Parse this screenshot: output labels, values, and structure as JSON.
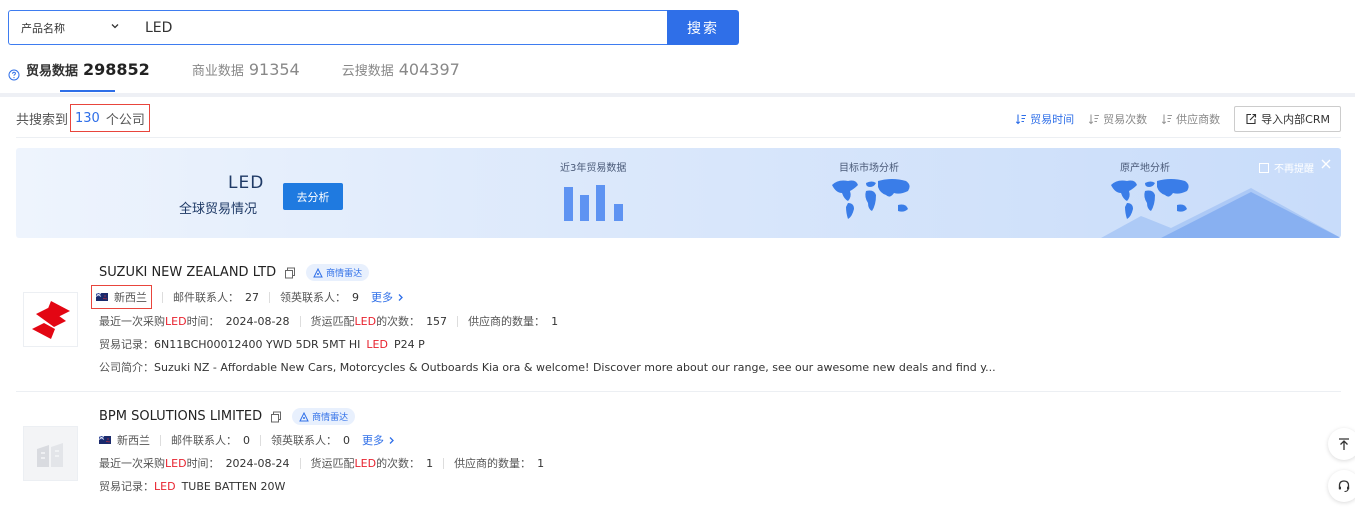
{
  "search": {
    "type_label": "产品名称",
    "query": "LED",
    "button_label": "搜索"
  },
  "tabs": [
    {
      "label": "贸易数据",
      "count": "298852",
      "active": true
    },
    {
      "label": "商业数据",
      "count": "91354",
      "active": false
    },
    {
      "label": "云搜数据",
      "count": "404397",
      "active": false
    }
  ],
  "results": {
    "prefix": "共搜索到",
    "count": "130",
    "unit": "个公司"
  },
  "sort": {
    "items": [
      "贸易时间",
      "贸易次数",
      "供应商数"
    ],
    "crm_button": "导入内部CRM"
  },
  "banner": {
    "keyword": "LED",
    "subtitle": "全球贸易情况",
    "analyze_button": "去分析",
    "sections": [
      "近3年贸易数据",
      "目标市场分析",
      "原产地分析"
    ],
    "no_remind": "不再提醒"
  },
  "companies": [
    {
      "name": "SUZUKI NEW ZEALAND LTD",
      "badge": "商情雷达",
      "country": "新西兰",
      "email_contacts_label": "邮件联系人：",
      "email_contacts": "27",
      "linkedin_contacts_label": "领英联系人：",
      "linkedin_contacts": "9",
      "more_label": "更多",
      "last_purchase_pre": "最近一次采购",
      "last_purchase_kw": "LED",
      "last_purchase_post": "时间：",
      "last_purchase_date": "2024-08-28",
      "match_pre": "货运匹配",
      "match_kw": "LED",
      "match_post": "的次数：",
      "match_count": "157",
      "supplier_label": "供应商的数量：",
      "supplier_count": "1",
      "trade_record_label": "贸易记录：",
      "trade_record_pre": "6N11BCH00012400 YWD 5DR 5MT HI",
      "trade_record_kw": "LED",
      "trade_record_post": "P24 P",
      "intro_label": "公司简介：",
      "intro": "Suzuki NZ - Affordable New Cars, Motorcycles & Outboards Kia ora & welcome! Discover more about our range, see our awesome new deals and find y..."
    },
    {
      "name": "BPM SOLUTIONS LIMITED",
      "badge": "商情雷达",
      "country": "新西兰",
      "email_contacts_label": "邮件联系人：",
      "email_contacts": "0",
      "linkedin_contacts_label": "领英联系人：",
      "linkedin_contacts": "0",
      "more_label": "更多",
      "last_purchase_pre": "最近一次采购",
      "last_purchase_kw": "LED",
      "last_purchase_post": "时间：",
      "last_purchase_date": "2024-08-24",
      "match_pre": "货运匹配",
      "match_kw": "LED",
      "match_post": "的次数：",
      "match_count": "1",
      "supplier_label": "供应商的数量：",
      "supplier_count": "1",
      "trade_record_label": "贸易记录：",
      "trade_record_kw": "LED",
      "trade_record_post": "TUBE BATTEN 20W"
    }
  ],
  "colors": {
    "accent": "#2f6fe8",
    "highlight": "#e8222e",
    "suzuki_red": "#e30613"
  }
}
